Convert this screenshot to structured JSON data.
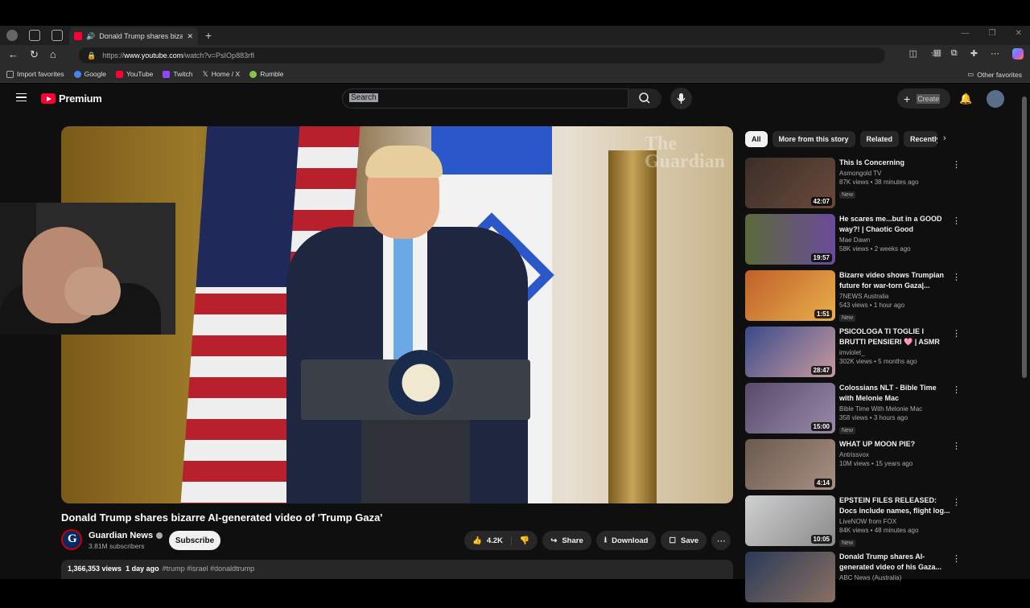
{
  "browser": {
    "tab_title": "Donald Trump shares bizarre",
    "url_prefix": "https://",
    "url_domain": "www.youtube.com",
    "url_path": "/watch?v=PsIOp883rfI",
    "bookmarks": [
      {
        "label": "Import favorites",
        "color": "#888888"
      },
      {
        "label": "Google",
        "color": "#4285f4"
      },
      {
        "label": "YouTube",
        "color": "#ff0033"
      },
      {
        "label": "Twitch",
        "color": "#9146ff"
      },
      {
        "label": "Home / X",
        "color": "#ffffff"
      },
      {
        "label": "Rumble",
        "color": "#85c742"
      }
    ],
    "other_favorites": "Other favorites"
  },
  "youtube": {
    "brand": "Premium",
    "search_placeholder": "Search",
    "create_label": "Create"
  },
  "video": {
    "watermark_line1": "The",
    "watermark_line2": "Guardian",
    "title": "Donald Trump shares bizarre AI-generated video of 'Trump Gaza'",
    "channel": "Guardian News",
    "subscribers": "3.81M subscribers",
    "subscribe_label": "Subscribe",
    "likes": "4.2K",
    "share_label": "Share",
    "download_label": "Download",
    "save_label": "Save",
    "views": "1,366,353 views",
    "age": "1 day ago",
    "tags": "#trump #israel #donaldtrump"
  },
  "chips": [
    "All",
    "More from this story",
    "Related",
    "Recently uploaded"
  ],
  "recommendations": [
    {
      "title": "This Is Concerning",
      "channel": "Asmongold TV",
      "meta": "87K views • 38 minutes ago",
      "badge": "New",
      "duration": "42:07",
      "thumb": "#3a2e28"
    },
    {
      "title": "He scares me...but in a GOOD way?! | Chaotic Good Barbaria...",
      "channel": "Mae Dawn",
      "meta": "58K views • 2 weeks ago",
      "badge": "",
      "duration": "19:57",
      "thumb": "#5b6a3a"
    },
    {
      "title": "Bizarre video shows Trumpian future for war-torn Gaza|...",
      "channel": "7NEWS Australia",
      "meta": "543 views • 1 hour ago",
      "badge": "New",
      "duration": "1:51",
      "thumb": "#c0602a"
    },
    {
      "title": "PSICOLOGA TI TOGLIE I BRUTTI PENSIERI 🩷 | ASMR Personal...",
      "channel": "imviolet_",
      "meta": "302K views • 5 months ago",
      "badge": "",
      "duration": "28:47",
      "thumb": "#3a4a8a"
    },
    {
      "title": "Colossians NLT - Bible Time with Melonie Mac",
      "channel": "Bible Time With Melonie Mac",
      "meta": "358 views • 3 hours ago",
      "badge": "New",
      "duration": "15:00",
      "thumb": "#5a4a6a"
    },
    {
      "title": "WHAT UP MOON PIE?",
      "channel": "Antrissvox",
      "meta": "10M views • 15 years ago",
      "badge": "",
      "duration": "4:14",
      "thumb": "#6a5a50"
    },
    {
      "title": "EPSTEIN FILES RELEASED: Docs include names, flight log...",
      "channel": "LiveNOW from FOX",
      "meta": "84K views • 48 minutes ago",
      "badge": "New",
      "duration": "10:05",
      "thumb": "#8a8a8a"
    },
    {
      "title": "Donald Trump shares AI-generated video of his Gaza...",
      "channel": "ABC News (Australia)",
      "meta": "",
      "badge": "",
      "duration": "",
      "thumb": "#2a3a5a"
    }
  ]
}
